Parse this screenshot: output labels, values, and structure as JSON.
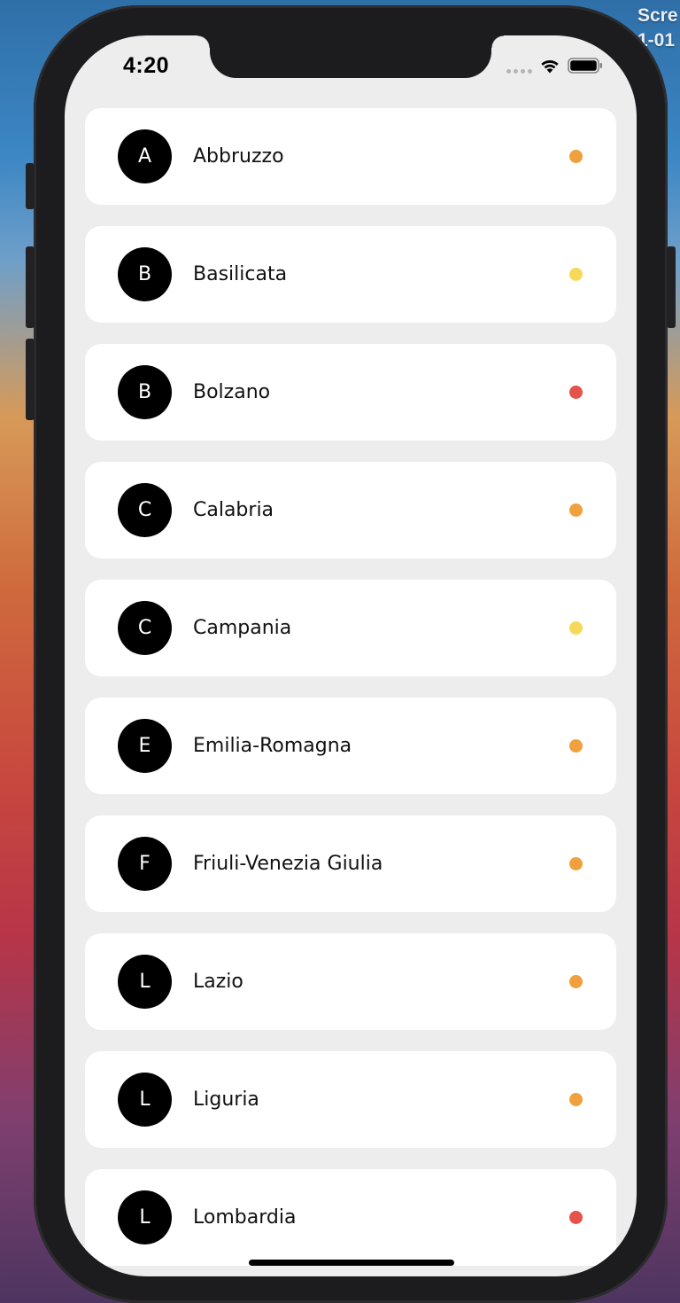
{
  "desktop": {
    "label_line1": "Scre",
    "label_line2": "1-01"
  },
  "status_bar": {
    "time": "4:20",
    "icons": [
      "cellular-signal-icon",
      "wifi-icon",
      "battery-icon"
    ]
  },
  "colors": {
    "orange": "#f0a03c",
    "yellow": "#f7d95a",
    "red": "#e5534b"
  },
  "regions": [
    {
      "initial": "A",
      "name": "Abbruzzo",
      "status": "orange"
    },
    {
      "initial": "B",
      "name": "Basilicata",
      "status": "yellow"
    },
    {
      "initial": "B",
      "name": "Bolzano",
      "status": "red"
    },
    {
      "initial": "C",
      "name": "Calabria",
      "status": "orange"
    },
    {
      "initial": "C",
      "name": "Campania",
      "status": "yellow"
    },
    {
      "initial": "E",
      "name": "Emilia-Romagna",
      "status": "orange"
    },
    {
      "initial": "F",
      "name": "Friuli-Venezia Giulia",
      "status": "orange"
    },
    {
      "initial": "L",
      "name": "Lazio",
      "status": "orange"
    },
    {
      "initial": "L",
      "name": "Liguria",
      "status": "orange"
    },
    {
      "initial": "L",
      "name": "Lombardia",
      "status": "red"
    }
  ]
}
